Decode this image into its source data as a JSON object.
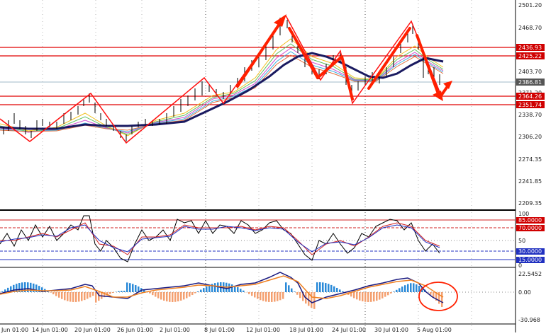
{
  "colors": {
    "background": "#ffffff",
    "grid": "#555555",
    "bull_candle": "#000000",
    "level_line": "#e00000",
    "annotation": "#ff2000",
    "ma_slow": "#1a1a60",
    "stoch_main": "#000000",
    "stoch_signal": "#d02020",
    "stoch_blue": "#2030c0",
    "hist_pos": "#2a8ad8",
    "hist_neg": "#f4a070",
    "macd_line": "#1a1a80",
    "signal_line": "#f08020",
    "price_tag": "#555555",
    "level_tag": "#d00000"
  },
  "price_axis": {
    "labels": [
      "2501.20",
      "2468.70",
      "2436.93",
      "2425.22",
      "2403.70",
      "2386.81",
      "2371.20",
      "2364.26",
      "2351.74",
      "2338.70",
      "2306.20",
      "2274.35",
      "2241.85",
      "2209.35"
    ]
  },
  "price_tags": {
    "current": "2386.81",
    "levels": [
      "2436.93",
      "2425.22",
      "2364.26",
      "2351.74"
    ]
  },
  "stoch_axis": {
    "top": "100",
    "mid": "50",
    "bottom": "0",
    "levels": [
      "85.0000",
      "70.0000",
      "30.0000",
      "15.0000"
    ]
  },
  "macd_axis": {
    "top": "22.5452",
    "zero": "0.00",
    "bottom": "-30.968"
  },
  "time_axis": {
    "labels": [
      "Jun 01:00",
      "14 Jun 01:00",
      "20 Jun 01:00",
      "26 Jun 01:00",
      "2 Jul 01:00",
      "8 Jul 01:00",
      "12 Jul 01:00",
      "18 Jul 01:00",
      "24 Jul 01:00",
      "30 Jul 01:00",
      "5 Aug 01:00"
    ]
  }
}
